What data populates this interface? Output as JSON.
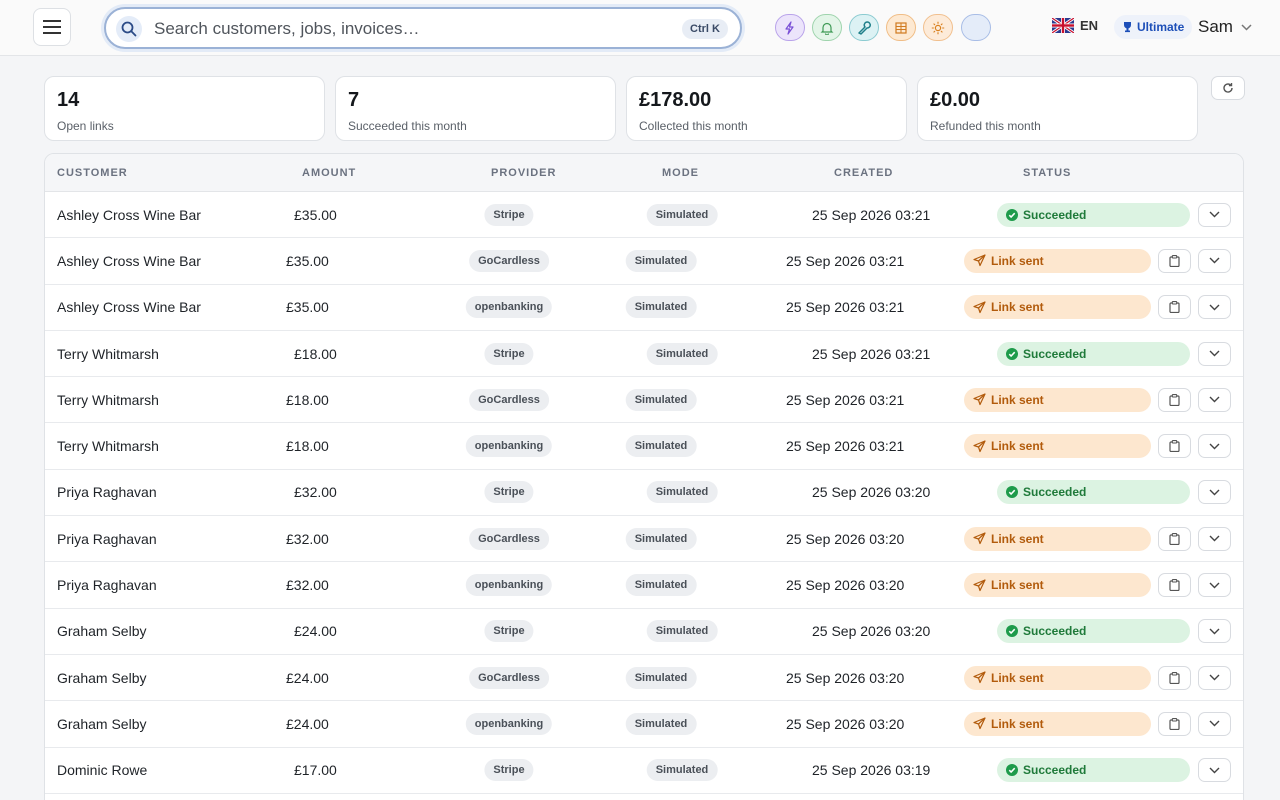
{
  "header": {
    "search_placeholder": "Search customers, jobs, invoices…",
    "shortcut": "Ctrl K",
    "language": "EN",
    "plan": "Ultimate",
    "user": "Sam",
    "quick_icons": [
      {
        "name": "lightning-icon",
        "bg": "#ece4fb",
        "border": "#b9a3ea",
        "color": "#7a4fd6"
      },
      {
        "name": "bell-icon",
        "bg": "#e3f5e8",
        "border": "#9fd4ad",
        "color": "#3f9a56"
      },
      {
        "name": "wrench-icon",
        "bg": "#dcf2f4",
        "border": "#8ccbd1",
        "color": "#1f7f89"
      },
      {
        "name": "grid-icon",
        "bg": "#fde9d2",
        "border": "#f0bd86",
        "color": "#d07a1f"
      },
      {
        "name": "sun-icon",
        "bg": "#fdebd9",
        "border": "#f1c08f",
        "color": "#d9801f"
      },
      {
        "name": "water-drop-icon",
        "bg": "#e4ecf9",
        "border": "#a8bde6",
        "color": "#3f6fc7"
      }
    ]
  },
  "stats": [
    {
      "value": "14",
      "caption": "Open links"
    },
    {
      "value": "7",
      "caption": "Succeeded this month"
    },
    {
      "value": "£178.00",
      "caption": "Collected this month"
    },
    {
      "value": "£0.00",
      "caption": "Refunded this month"
    }
  ],
  "table": {
    "columns": [
      "CUSTOMER",
      "AMOUNT",
      "PROVIDER",
      "MODE",
      "CREATED",
      "STATUS"
    ],
    "rows": [
      {
        "customer": "Ashley Cross Wine Bar",
        "amount": "£35.00",
        "provider": "Stripe",
        "mode": "Simulated",
        "created": "25 Sep 2026 03:21",
        "status": "Succeeded"
      },
      {
        "customer": "Ashley Cross Wine Bar",
        "amount": "£35.00",
        "provider": "GoCardless",
        "mode": "Simulated",
        "created": "25 Sep 2026 03:21",
        "status": "Link sent"
      },
      {
        "customer": "Ashley Cross Wine Bar",
        "amount": "£35.00",
        "provider": "openbanking",
        "mode": "Simulated",
        "created": "25 Sep 2026 03:21",
        "status": "Link sent"
      },
      {
        "customer": "Terry Whitmarsh",
        "amount": "£18.00",
        "provider": "Stripe",
        "mode": "Simulated",
        "created": "25 Sep 2026 03:21",
        "status": "Succeeded"
      },
      {
        "customer": "Terry Whitmarsh",
        "amount": "£18.00",
        "provider": "GoCardless",
        "mode": "Simulated",
        "created": "25 Sep 2026 03:21",
        "status": "Link sent"
      },
      {
        "customer": "Terry Whitmarsh",
        "amount": "£18.00",
        "provider": "openbanking",
        "mode": "Simulated",
        "created": "25 Sep 2026 03:21",
        "status": "Link sent"
      },
      {
        "customer": "Priya Raghavan",
        "amount": "£32.00",
        "provider": "Stripe",
        "mode": "Simulated",
        "created": "25 Sep 2026 03:20",
        "status": "Succeeded"
      },
      {
        "customer": "Priya Raghavan",
        "amount": "£32.00",
        "provider": "GoCardless",
        "mode": "Simulated",
        "created": "25 Sep 2026 03:20",
        "status": "Link sent"
      },
      {
        "customer": "Priya Raghavan",
        "amount": "£32.00",
        "provider": "openbanking",
        "mode": "Simulated",
        "created": "25 Sep 2026 03:20",
        "status": "Link sent"
      },
      {
        "customer": "Graham Selby",
        "amount": "£24.00",
        "provider": "Stripe",
        "mode": "Simulated",
        "created": "25 Sep 2026 03:20",
        "status": "Succeeded"
      },
      {
        "customer": "Graham Selby",
        "amount": "£24.00",
        "provider": "GoCardless",
        "mode": "Simulated",
        "created": "25 Sep 2026 03:20",
        "status": "Link sent"
      },
      {
        "customer": "Graham Selby",
        "amount": "£24.00",
        "provider": "openbanking",
        "mode": "Simulated",
        "created": "25 Sep 2026 03:20",
        "status": "Link sent"
      },
      {
        "customer": "Dominic Rowe",
        "amount": "£17.00",
        "provider": "Stripe",
        "mode": "Simulated",
        "created": "25 Sep 2026 03:19",
        "status": "Succeeded"
      },
      {
        "customer": "",
        "amount": "",
        "provider": "",
        "mode": "",
        "created": "",
        "status": ""
      }
    ]
  }
}
